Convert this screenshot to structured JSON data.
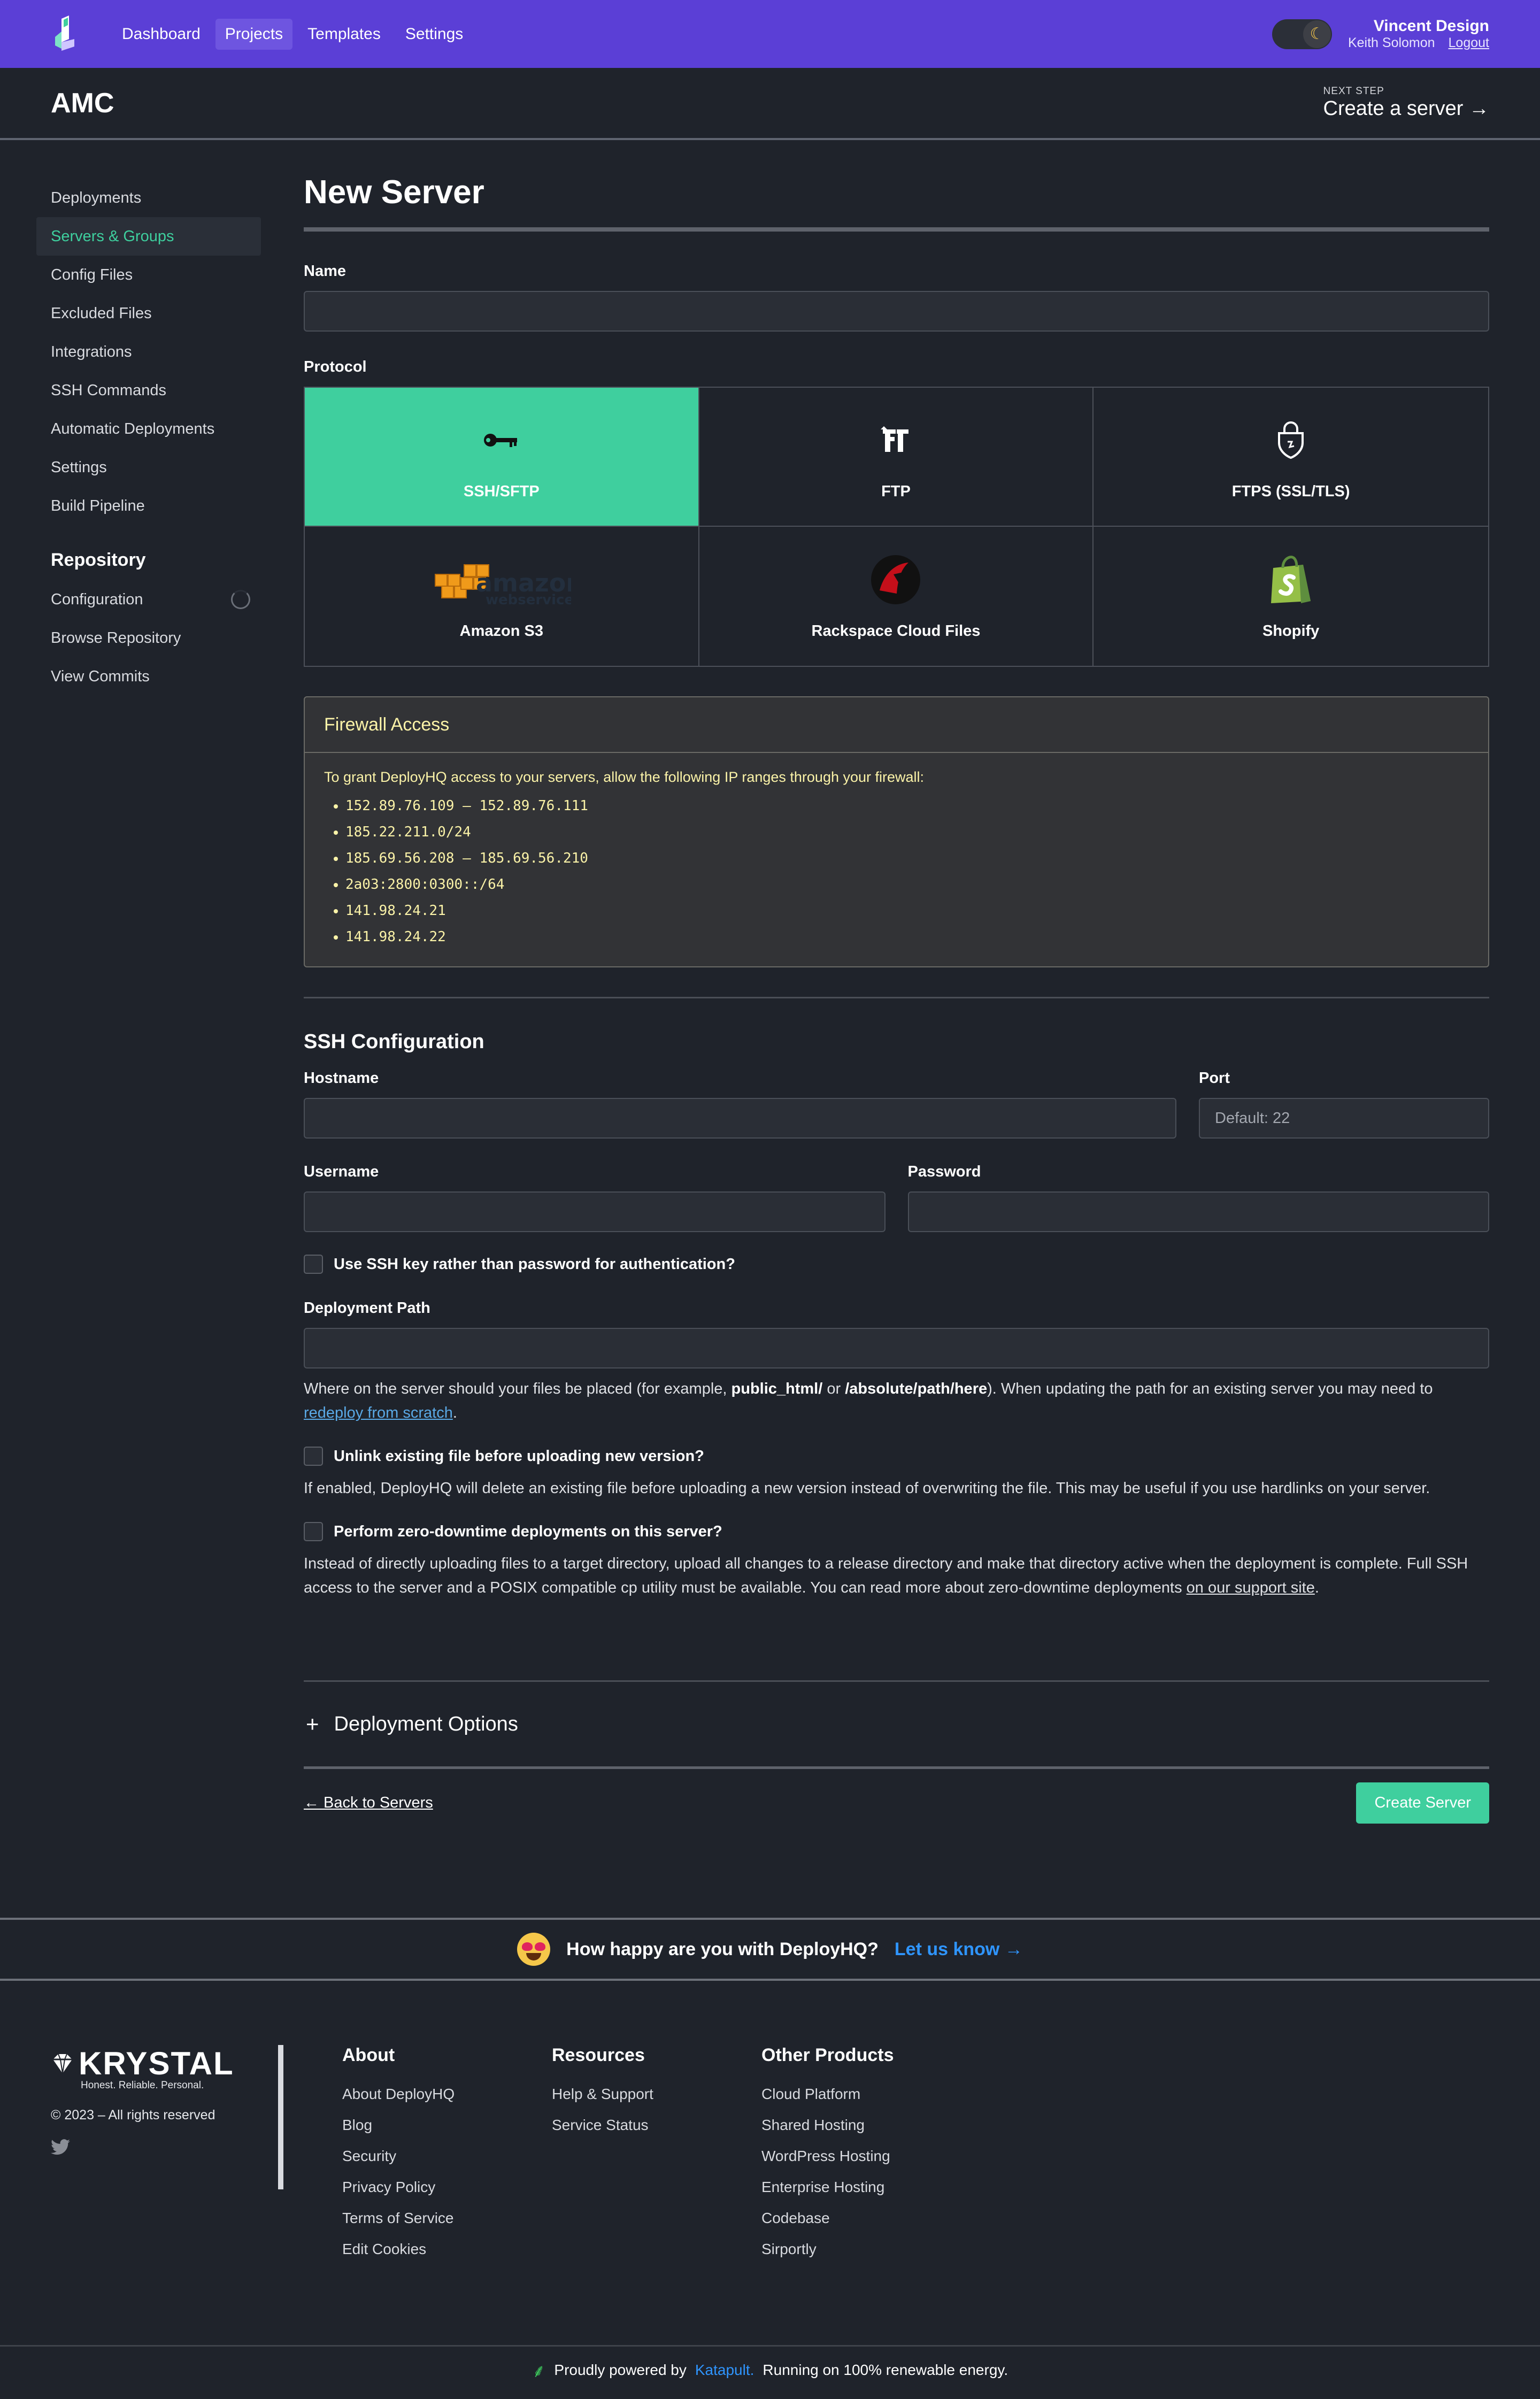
{
  "nav": {
    "links": [
      "Dashboard",
      "Projects",
      "Templates",
      "Settings"
    ],
    "user_name": "Vincent Design",
    "user_sub": "Keith Solomon",
    "logout": "Logout"
  },
  "project": {
    "title": "AMC",
    "next_step_label": "NEXT STEP",
    "next_step_link": "Create a server →"
  },
  "sidebar": {
    "items": [
      "Deployments",
      "Servers & Groups",
      "Config Files",
      "Excluded Files",
      "Integrations",
      "SSH Commands",
      "Automatic Deployments",
      "Settings",
      "Build Pipeline"
    ],
    "repo_heading": "Repository",
    "repo_items": [
      "Configuration",
      "Browse Repository",
      "View Commits"
    ]
  },
  "form": {
    "title": "New Server",
    "name_label": "Name",
    "protocol_label": "Protocol",
    "protocols": [
      "SSH/SFTP",
      "FTP",
      "FTPS (SSL/TLS)",
      "Amazon S3",
      "Rackspace Cloud Files",
      "Shopify"
    ],
    "firewall": {
      "title": "Firewall Access",
      "intro": "To grant DeployHQ access to your servers, allow the following IP ranges through your firewall:",
      "ips": [
        "152.89.76.109 – 152.89.76.111",
        "185.22.211.0/24",
        "185.69.56.208 – 185.69.56.210",
        "2a03:2800:0300::/64",
        "141.98.24.21",
        "141.98.24.22"
      ]
    },
    "ssh": {
      "title": "SSH Configuration",
      "hostname_label": "Hostname",
      "port_label": "Port",
      "port_placeholder": "Default: 22",
      "username_label": "Username",
      "password_label": "Password",
      "ssh_key_label": "Use SSH key rather than password for authentication?",
      "path_label": "Deployment Path",
      "path_help_1": "Where on the server should your files be placed (for example, ",
      "path_help_b1": "public_html/",
      "path_help_2": " or ",
      "path_help_b2": "/absolute/path/here",
      "path_help_3": "). When updating the path for an existing server you may need to ",
      "path_help_link": "redeploy from scratch",
      "path_help_4": ".",
      "unlink_label": "Unlink existing file before uploading new version?",
      "unlink_help": "If enabled, DeployHQ will delete an existing file before uploading a new version instead of overwriting the file. This may be useful if you use hardlinks on your server.",
      "zero_label": "Perform zero-downtime deployments on this server?",
      "zero_help": "Instead of directly uploading files to a target directory, upload all changes to a release directory and make that directory active when the deployment is complete. Full SSH access to the server and a POSIX compatible cp utility must be available. You can read more about zero-downtime deployments ",
      "zero_link": "on our support site",
      "zero_end": "."
    },
    "options_title": "Deployment Options",
    "back": "← Back to Servers",
    "submit": "Create Server"
  },
  "feedback": {
    "question": "How happy are you with DeployHQ?",
    "link": "Let us know →"
  },
  "footer": {
    "brand": "KRYSTAL",
    "tagline": "Honest. Reliable. Personal.",
    "copyright": "© 2023 – All rights reserved",
    "columns": [
      {
        "title": "About",
        "links": [
          "About DeployHQ",
          "Blog",
          "Security",
          "Privacy Policy",
          "Terms of Service",
          "Edit Cookies"
        ]
      },
      {
        "title": "Resources",
        "links": [
          "Help & Support",
          "Service Status"
        ]
      },
      {
        "title": "Other Products",
        "links": [
          "Cloud Platform",
          "Shared Hosting",
          "WordPress Hosting",
          "Enterprise Hosting",
          "Codebase",
          "Sirportly"
        ]
      }
    ],
    "powered_1": "Proudly powered by",
    "powered_link": "Katapult.",
    "powered_2": "Running on 100% renewable energy."
  },
  "colors": {
    "accent": "#5b3fd6",
    "green": "#3fcf9e",
    "firewall_text": "#fbf3a8",
    "link_blue": "#2f95ff"
  }
}
